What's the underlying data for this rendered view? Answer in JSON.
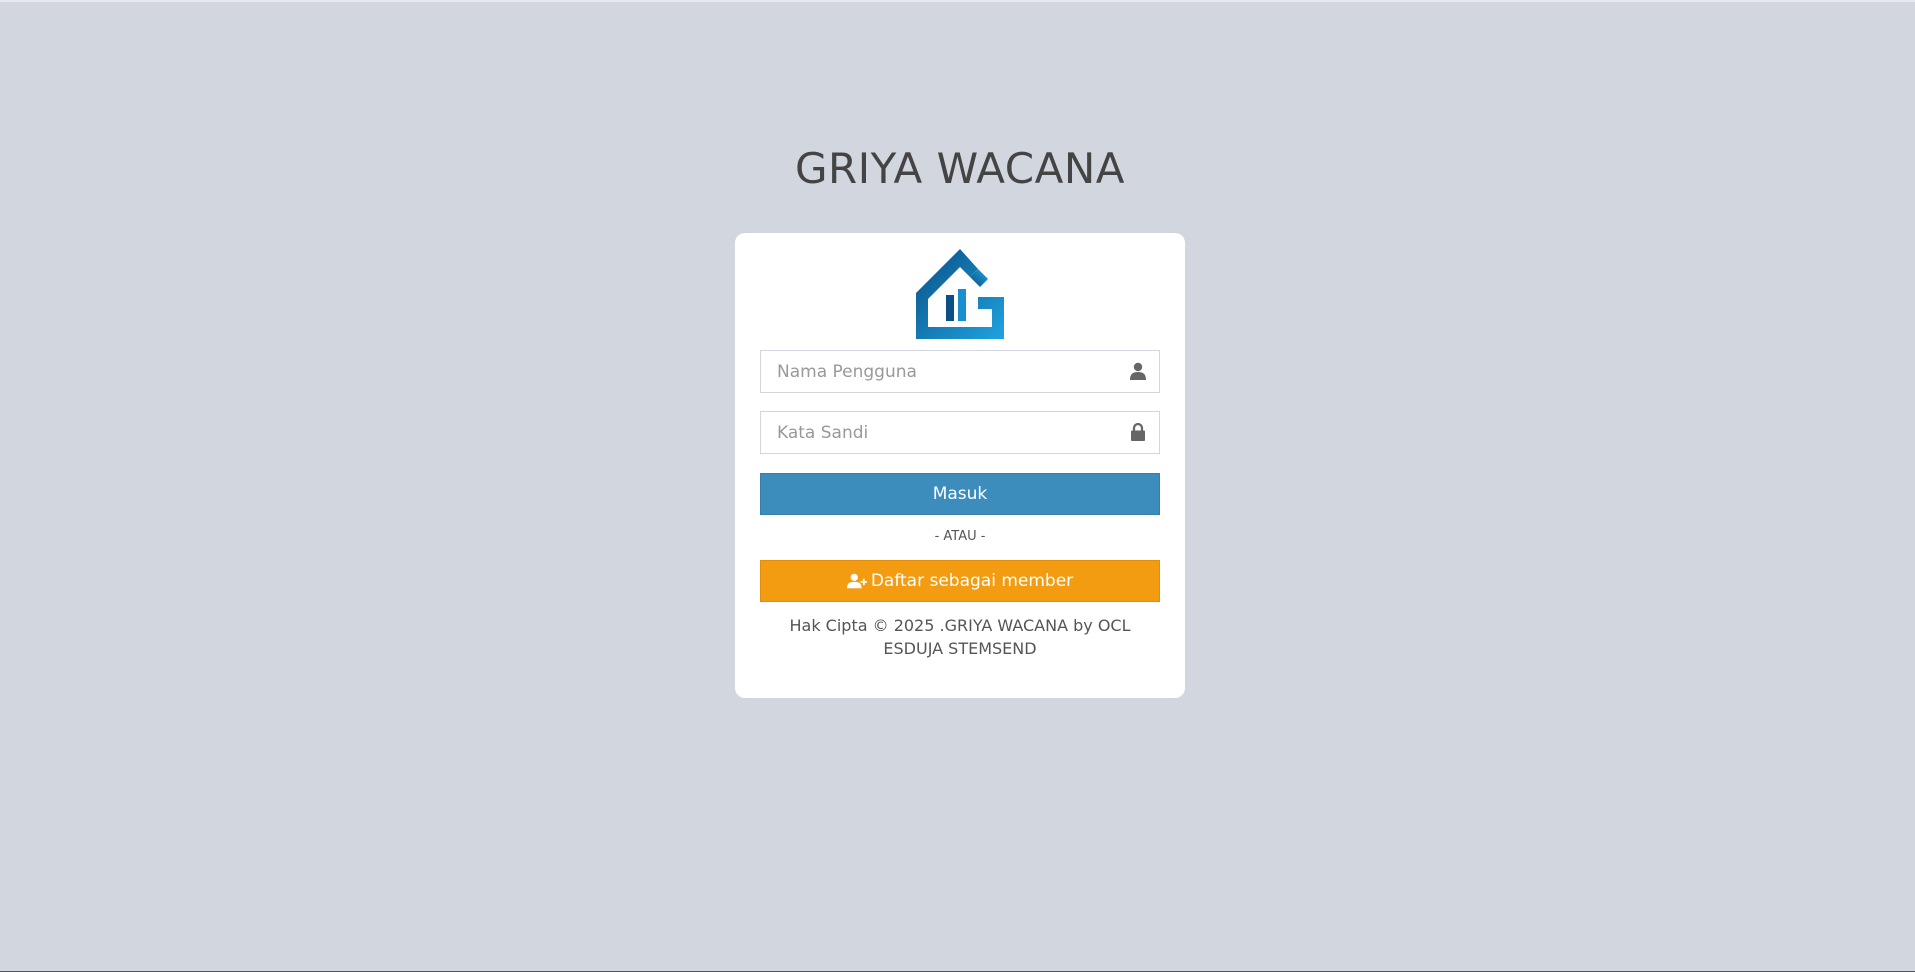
{
  "site": {
    "title": "GRIYA WACANA"
  },
  "logo": {
    "icon": "griya-wacana-house-logo",
    "colors": [
      "#0a4f86",
      "#1fa3e0"
    ]
  },
  "form": {
    "username": {
      "placeholder": "Nama Pengguna",
      "value": "",
      "icon": "user-icon"
    },
    "password": {
      "placeholder": "Kata Sandi",
      "value": "",
      "icon": "lock-icon"
    },
    "login_label": "Masuk",
    "separator": "- ATAU -",
    "register_label": "Daftar sebagai member",
    "register_icon": "user-plus-icon"
  },
  "footer": {
    "copyright": "Hak Cipta © 2025 .GRIYA WACANA by OCL ESDUJA STEMSEND"
  },
  "colors": {
    "background": "#d2d6de",
    "primary": "#3c8dbc",
    "warning": "#f39c12",
    "card": "#ffffff"
  }
}
